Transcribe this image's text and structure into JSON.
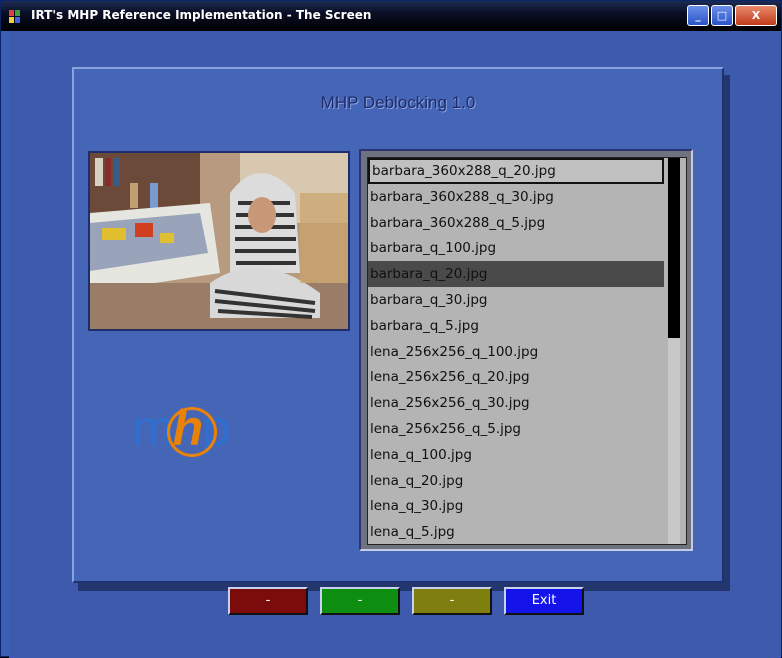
{
  "window": {
    "title": "IRT's MHP Reference Implementation - The Screen",
    "buttons": {
      "minimize": "_",
      "maximize": "□",
      "close": "X"
    }
  },
  "app": {
    "title": "MHP Deblocking 1.0",
    "logo": "mhp"
  },
  "file_list": {
    "items": [
      "barbara_360x288_q_20.jpg",
      "barbara_360x288_q_30.jpg",
      "barbara_360x288_q_5.jpg",
      "barbara_q_100.jpg",
      "barbara_q_20.jpg",
      "barbara_q_30.jpg",
      "barbara_q_5.jpg",
      "lena_256x256_q_100.jpg",
      "lena_256x256_q_20.jpg",
      "lena_256x256_q_30.jpg",
      "lena_256x256_q_5.jpg",
      "lena_q_100.jpg",
      "lena_q_20.jpg",
      "lena_q_30.jpg",
      "lena_q_5.jpg"
    ],
    "focused_index": 0,
    "selected_index": 4
  },
  "color_buttons": {
    "red": "-",
    "green": "-",
    "yellow": "-",
    "blue": "Exit"
  },
  "colors": {
    "background": "#3d5aac",
    "panel": "#4565b6",
    "red": "#7c0b0b",
    "green": "#0e8e10",
    "yellow": "#7f7f10",
    "blue": "#1414ea",
    "logo_blue": "#2f6fd0",
    "logo_orange": "#e8830a"
  }
}
